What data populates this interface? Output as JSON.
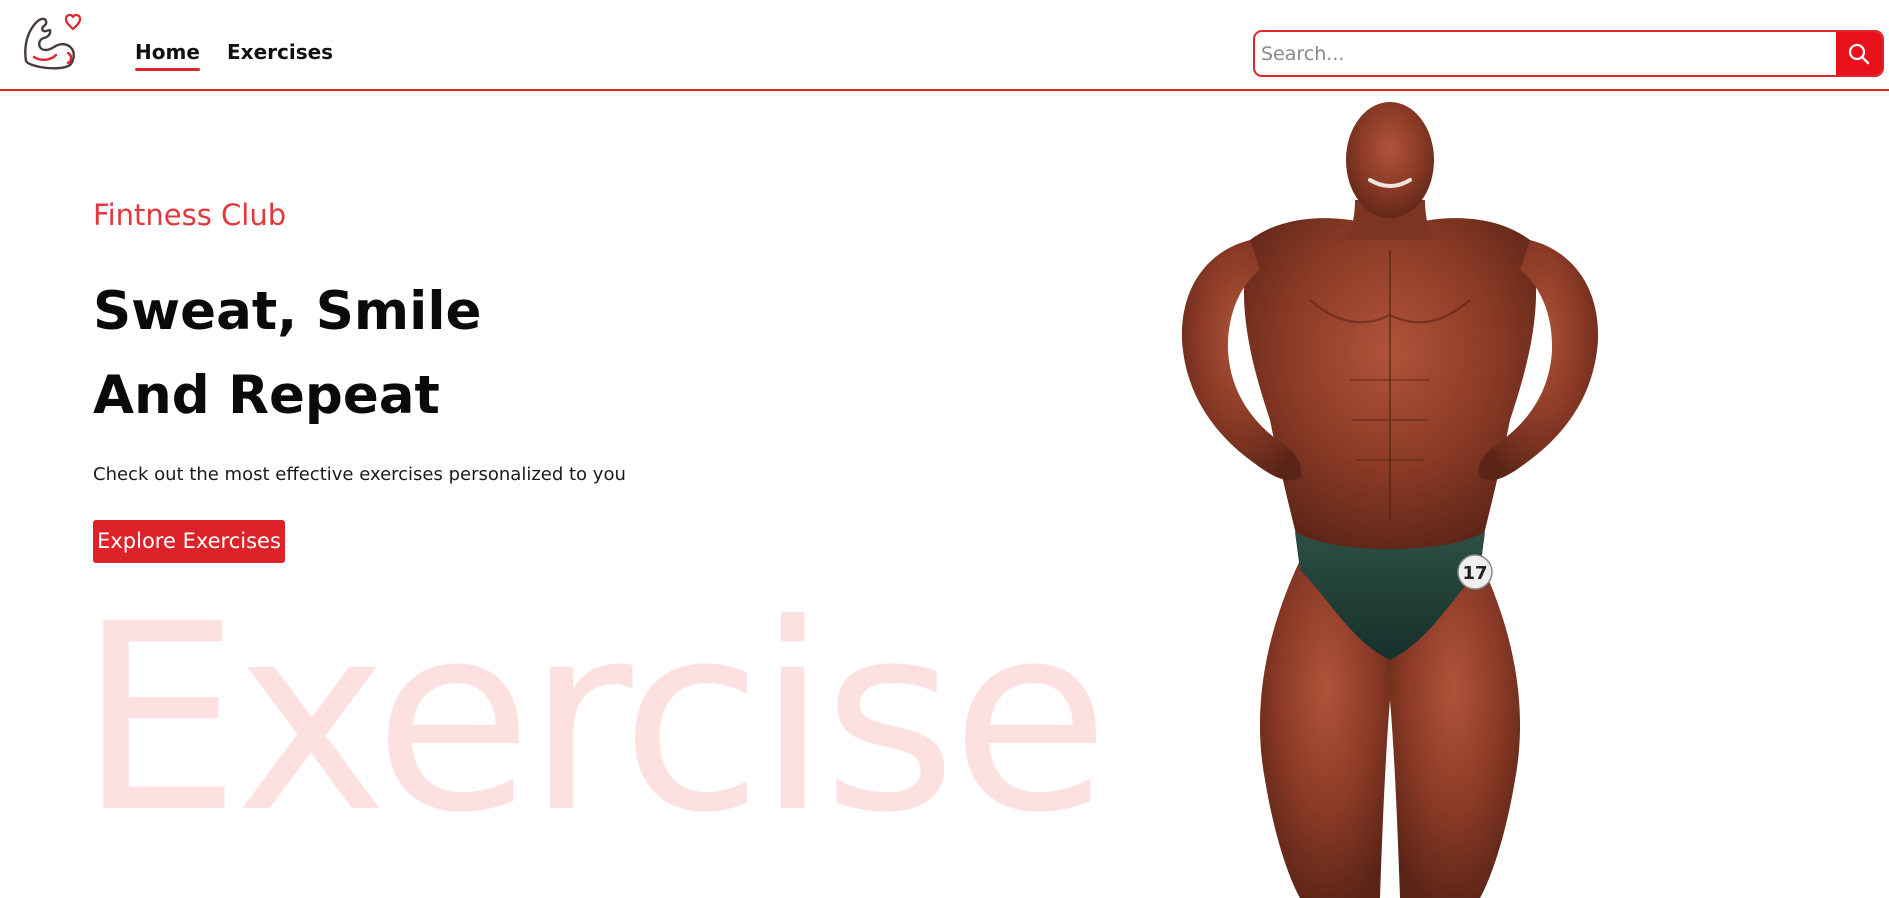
{
  "nav": {
    "logo_icon": "flexed-arm-heart-icon",
    "links": [
      {
        "label": "Home",
        "active": true
      },
      {
        "label": "Exercises",
        "active": false
      }
    ]
  },
  "search": {
    "placeholder": "Search...",
    "value": "",
    "button_icon": "search-icon"
  },
  "hero": {
    "eyebrow": "Fintness Club",
    "headline": [
      "Sweat, Smile",
      "And Repeat"
    ],
    "subtitle": "Check out the most effective exercises personalized to you",
    "cta_label": "Explore Exercises",
    "watermark": "Exercise",
    "badge_number": "17"
  },
  "colors": {
    "accent": "#e0262b",
    "watermark": "#fde1e1",
    "eyebrow": "#e3373d"
  }
}
